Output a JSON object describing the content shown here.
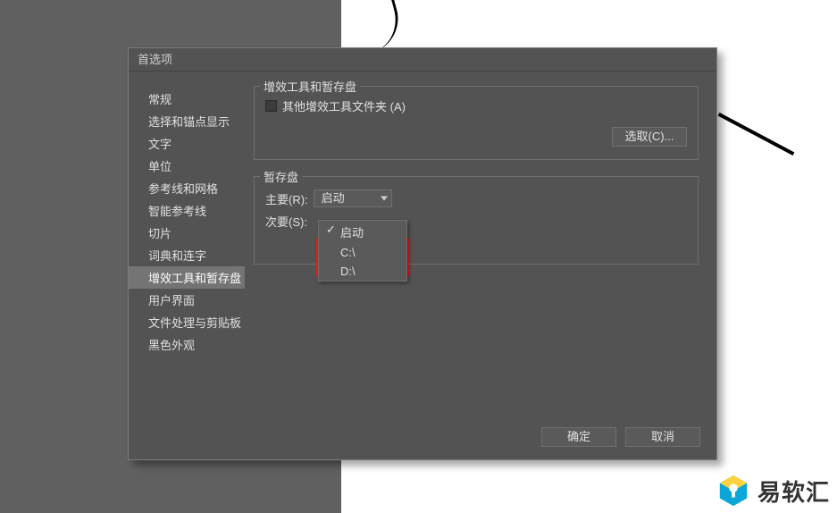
{
  "dialog": {
    "title": "首选项"
  },
  "sidebar": {
    "items": [
      {
        "label": "常规"
      },
      {
        "label": "选择和锚点显示"
      },
      {
        "label": "文字"
      },
      {
        "label": "单位"
      },
      {
        "label": "参考线和网格"
      },
      {
        "label": "智能参考线"
      },
      {
        "label": "切片"
      },
      {
        "label": "词典和连字"
      },
      {
        "label": "增效工具和暂存盘"
      },
      {
        "label": "用户界面"
      },
      {
        "label": "文件处理与剪贴板"
      },
      {
        "label": "黑色外观"
      }
    ],
    "selected_index": 8
  },
  "group_plugins": {
    "title": "增效工具和暂存盘",
    "checkbox_label": "其他增效工具文件夹 (A)",
    "choose_button": "选取(C)..."
  },
  "group_scratch": {
    "title": "暂存盘",
    "primary_label": "主要(R):",
    "primary_value": "启动",
    "secondary_label": "次要(S):",
    "dropdown_options": [
      {
        "label": "启动",
        "checked": true
      },
      {
        "label": "C:\\",
        "checked": false
      },
      {
        "label": "D:\\",
        "checked": false
      }
    ]
  },
  "footer": {
    "ok": "确定",
    "cancel": "取消"
  },
  "logo": {
    "text": "易软汇"
  }
}
